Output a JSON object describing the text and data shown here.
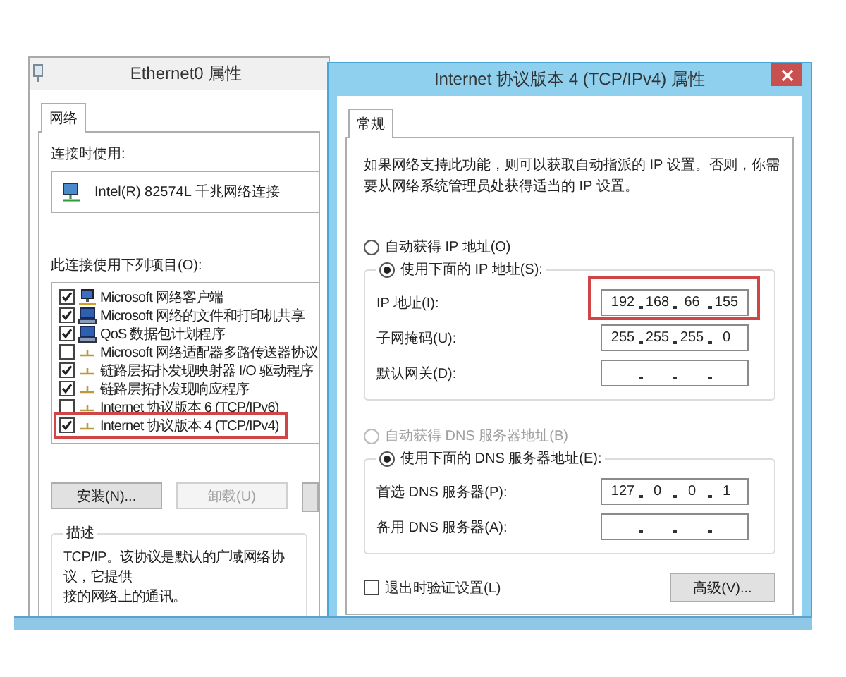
{
  "adapter_window": {
    "title": "Ethernet0 属性",
    "tabs": [
      {
        "label": "网络",
        "selected": true
      }
    ],
    "connect_label": "连接时使用:",
    "adapter": "Intel(R) 82574L 千兆网络连接",
    "items_label": "此连接使用下列项目(O):",
    "items": [
      {
        "label": "Microsoft 网络客户端",
        "checked": true,
        "kind": "client",
        "highlighted": false
      },
      {
        "label": "Microsoft 网络的文件和打印机共享",
        "checked": true,
        "kind": "service",
        "highlighted": false
      },
      {
        "label": "QoS 数据包计划程序",
        "checked": true,
        "kind": "service",
        "highlighted": false
      },
      {
        "label": "Microsoft 网络适配器多路传送器协议",
        "checked": false,
        "kind": "protocol",
        "highlighted": false
      },
      {
        "label": "链路层拓扑发现映射器 I/O 驱动程序",
        "checked": true,
        "kind": "protocol",
        "highlighted": false
      },
      {
        "label": "链路层拓扑发现响应程序",
        "checked": true,
        "kind": "protocol",
        "highlighted": false
      },
      {
        "label": "Internet 协议版本 6 (TCP/IPv6)",
        "checked": false,
        "kind": "protocol",
        "highlighted": false
      },
      {
        "label": "Internet 协议版本 4 (TCP/IPv4)",
        "checked": true,
        "kind": "protocol",
        "highlighted": true
      }
    ],
    "buttons": [
      {
        "label": "安装(N)...",
        "disabled": false
      },
      {
        "label": "卸载(U)",
        "disabled": true
      }
    ],
    "description_label": "描述",
    "description_lines": [
      "TCP/IP。该协议是默认的广域网络协议，它提供",
      "接的网络上的通讯。"
    ]
  },
  "ipv4_window": {
    "title": "Internet 协议版本 4 (TCP/IPv4) 属性",
    "tabs": [
      {
        "label": "常规",
        "selected": true
      }
    ],
    "intro": "如果网络支持此功能，则可以获取自动指派的 IP 设置。否则，你需要从网络系统管理员处获得适当的 IP 设置。",
    "ip_modes": [
      {
        "label": "自动获得 IP 地址(O)",
        "selected": false,
        "disabled": false
      },
      {
        "label": "使用下面的 IP 地址(S):",
        "selected": true,
        "disabled": false
      }
    ],
    "ip_fields": [
      {
        "label": "IP 地址(I):",
        "octets": [
          "192",
          "168",
          "66",
          "155"
        ],
        "highlighted": true
      },
      {
        "label": "子网掩码(U):",
        "octets": [
          "255",
          "255",
          "255",
          "0"
        ],
        "highlighted": false
      },
      {
        "label": "默认网关(D):",
        "highlighted": false
      }
    ],
    "dns_modes": [
      {
        "label": "自动获得 DNS 服务器地址(B)",
        "selected": false,
        "disabled": true
      },
      {
        "label": "使用下面的 DNS 服务器地址(E):",
        "selected": true,
        "disabled": false
      }
    ],
    "dns_fields": [
      {
        "label": "首选 DNS 服务器(P):",
        "octets": [
          "127",
          "0",
          "0",
          "1"
        ],
        "highlighted": false
      },
      {
        "label": "备用 DNS 服务器(A):",
        "highlighted": false
      }
    ],
    "validate_on_exit": {
      "label": "退出时验证设置(L)",
      "checked": false
    },
    "advanced_button": "高级(V)..."
  }
}
